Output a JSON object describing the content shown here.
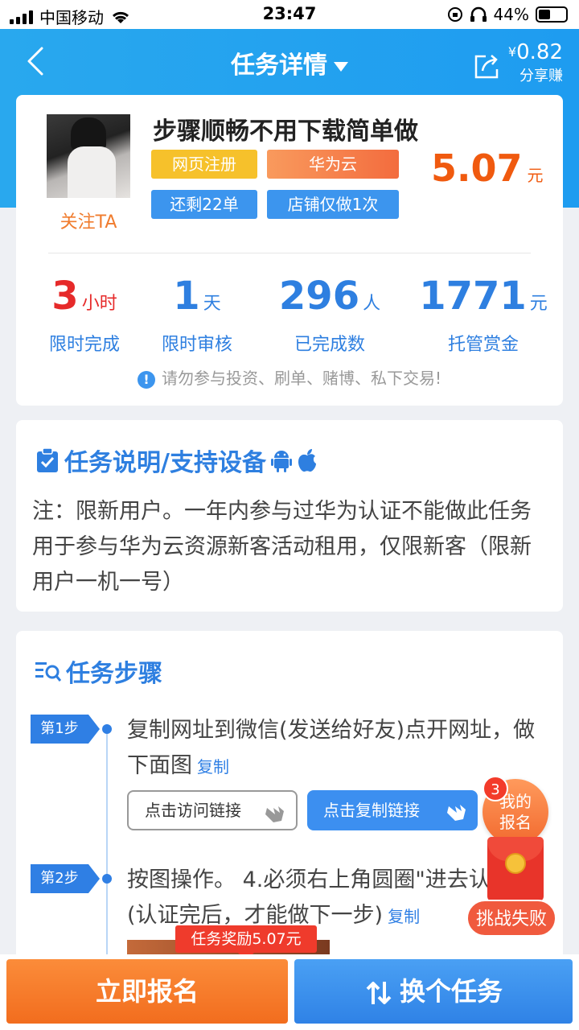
{
  "status_bar": {
    "carrier": "中国移动",
    "time": "23:47",
    "battery": "44%",
    "battery_level": 0.44
  },
  "header": {
    "title": "任务详情",
    "share_amount_symbol": "¥",
    "share_amount": "0.82",
    "share_label": "分享赚"
  },
  "task": {
    "follow_label": "关注TA",
    "title": "步骤顺畅不用下载简单做",
    "tags": [
      "网页注册",
      "华为云",
      "还剩22单",
      "店铺仅做1次"
    ],
    "reward_value": "5.07",
    "reward_unit": "元",
    "stats": [
      {
        "value": "3",
        "unit": "小时",
        "label": "限时完成"
      },
      {
        "value": "1",
        "unit": "天",
        "label": "限时审核"
      },
      {
        "value": "296",
        "unit": "人",
        "label": "已完成数"
      },
      {
        "value": "1771",
        "unit": "元",
        "label": "托管赏金"
      }
    ],
    "warning": "请勿参与投资、刷单、赌博、私下交易!"
  },
  "description": {
    "title": "任务说明/支持设备",
    "text": "注：限新用户。一年内参与过华为认证不能做此任务 用于参与华为云资源新客活动租用，仅限新客（限新用户一机一号）"
  },
  "steps": {
    "title": "任务步骤",
    "items": [
      {
        "badge": "第1步",
        "text": "复制网址到微信(发送给好友)点开网址，做下面图",
        "copy": "复制"
      },
      {
        "badge": "第2步",
        "text": "按图操作。 4.必须右上角圆圈\"进去认证\" (认证完后，才能做下一步)",
        "copy": "复制"
      }
    ],
    "visit_button": "点击访问链接",
    "copy_button": "点击复制链接"
  },
  "floating": {
    "my_signup_count": "3",
    "my_signup_label_1": "我的",
    "my_signup_label_2": "报名",
    "challenge_label": "挑战失败",
    "reward_tip": "任务奖励5.07元"
  },
  "bottom": {
    "signup_button": "立即报名",
    "switch_button": "换个任务"
  }
}
